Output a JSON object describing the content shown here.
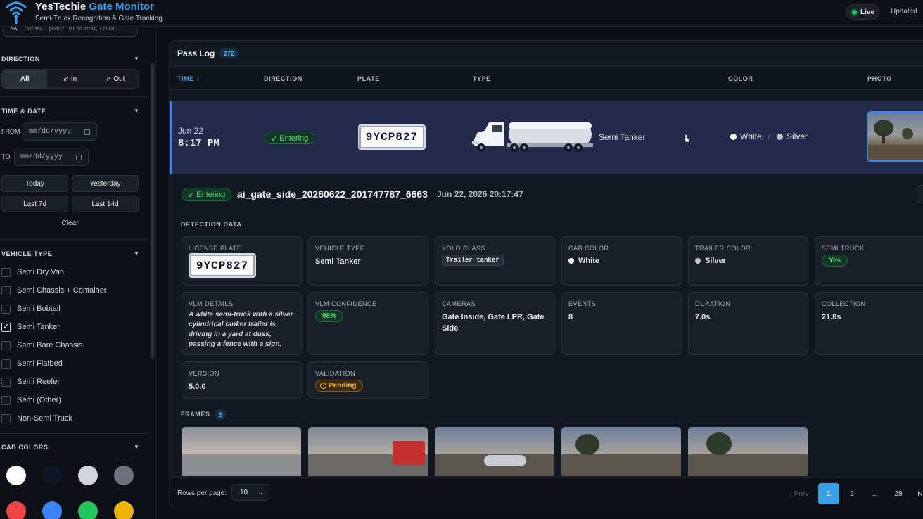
{
  "header": {
    "title_main": "YesTechie",
    "title_accent": "Gate Monitor",
    "subtitle": "Semi-Truck Recognition & Gate Tracking",
    "live_label": "Live",
    "updated_label": "Updated"
  },
  "icons": {
    "logo": "wifi-signal-icon",
    "search": "search-icon",
    "calendar": "calendar-icon",
    "chevron": "chevron-down-icon",
    "cursor": "mouse-pointer-icon"
  },
  "sidebar": {
    "search": {
      "placeholder": "Search plate, VLM text, color..."
    },
    "direction": {
      "title": "DIRECTION",
      "options": [
        "All",
        "↙ In",
        "↗ Out"
      ],
      "selected": "All"
    },
    "time_date": {
      "title": "TIME & DATE",
      "from_label": "FROM",
      "to_label": "TO",
      "from_placeholder": "mm/dd/yyyy",
      "to_placeholder": "mm/dd/yyyy",
      "quick": [
        "Today",
        "Yesterday",
        "Last 7d",
        "Last 14d"
      ],
      "clear_label": "Clear"
    },
    "vehicle_type": {
      "title": "VEHICLE TYPE",
      "items": [
        {
          "label": "Semi Dry Van",
          "checked": false
        },
        {
          "label": "Semi Chassis + Container",
          "checked": false
        },
        {
          "label": "Semi Bobtail",
          "checked": false
        },
        {
          "label": "Semi Tanker",
          "checked": true
        },
        {
          "label": "Semi Bare Chassis",
          "checked": false
        },
        {
          "label": "Semi Flatbed",
          "checked": false
        },
        {
          "label": "Semi Reefer",
          "checked": false
        },
        {
          "label": "Semi (Other)",
          "checked": false
        },
        {
          "label": "Non-Semi Truck",
          "checked": false
        }
      ]
    },
    "cab_colors": {
      "title": "CAB COLORS",
      "swatches": [
        "#ffffff",
        "#101527",
        "#d1d5db",
        "#6b7280",
        "#ef4444",
        "#3b82f6",
        "#22c55e",
        "#eab308"
      ]
    }
  },
  "pass_log": {
    "title": "Pass Log",
    "count": "272",
    "columns": [
      "TIME ↓",
      "DIRECTION",
      "PLATE",
      "TYPE",
      "COLOR",
      "PHOTO"
    ],
    "selected_row": {
      "date": "Jun 22",
      "time": "8:17 PM",
      "direction": "↙ Entering",
      "plate": "9YCP827",
      "type": "Semi Tanker",
      "cab_color": "White",
      "trailer_color": "Silver",
      "cab_color_hex": "#ffffff",
      "trailer_color_hex": "#c0c4ca"
    }
  },
  "detail": {
    "direction": "↙ Entering",
    "event_id": "ai_gate_side_20260622_201747787_6663",
    "timestamp": "Jun 22, 2026 20:17:47",
    "section_title": "DETECTION DATA",
    "cards": {
      "license_plate": {
        "label": "LICENSE PLATE",
        "value": "9YCP827"
      },
      "vehicle_type": {
        "label": "VEHICLE TYPE",
        "value": "Semi Tanker"
      },
      "yolo_class": {
        "label": "YOLO CLASS",
        "value": "Trailer tanker"
      },
      "cab_color": {
        "label": "CAB COLOR",
        "value": "White"
      },
      "trailer_color": {
        "label": "TRAILER COLOR",
        "value": "Silver"
      },
      "semi_truck": {
        "label": "SEMI TRUCK",
        "value": "Yes"
      },
      "vlm_details": {
        "label": "VLM DETAILS",
        "value": "A white semi-truck with a silver cylindrical tanker trailer is driving in a yard at dusk, passing a fence with a sign."
      },
      "vlm_confidence": {
        "label": "VLM CONFIDENCE",
        "value": "98%"
      },
      "cameras": {
        "label": "CAMERAS",
        "value": "Gate Inside, Gate LPR, Gate Side"
      },
      "events": {
        "label": "EVENTS",
        "value": "8"
      },
      "duration": {
        "label": "DURATION",
        "value": "7.0s"
      },
      "collection": {
        "label": "COLLECTION",
        "value": "21.8s"
      },
      "version": {
        "label": "VERSION",
        "value": "5.0.0"
      },
      "validation": {
        "label": "VALIDATION",
        "value": "Pending"
      }
    },
    "frames": {
      "title": "FRAMES",
      "count": "5"
    }
  },
  "footer": {
    "rows_label": "Rows per page:",
    "rows_value": "10",
    "prev_label": "‹ Prev",
    "pages": [
      "1",
      "2",
      "...",
      "28"
    ],
    "current_page": "1",
    "next_label": "N"
  }
}
